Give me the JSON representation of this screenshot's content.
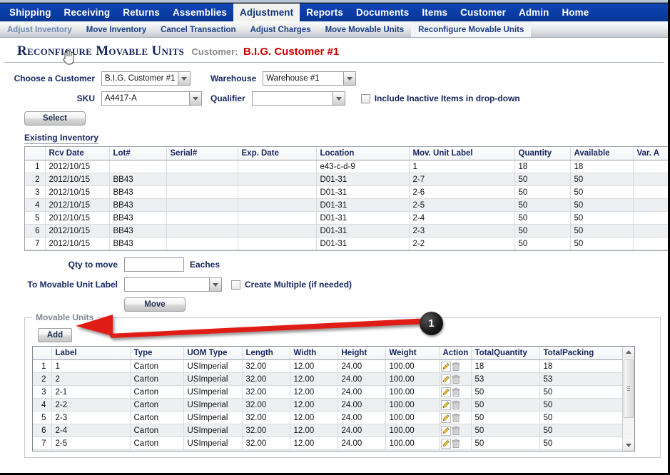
{
  "mainnav": {
    "items": [
      {
        "label": "Shipping",
        "active": false
      },
      {
        "label": "Receiving",
        "active": false
      },
      {
        "label": "Returns",
        "active": false
      },
      {
        "label": "Assemblies",
        "active": false
      },
      {
        "label": "Adjustment",
        "active": true
      },
      {
        "label": "Reports",
        "active": false
      },
      {
        "label": "Documents",
        "active": false
      },
      {
        "label": "Items",
        "active": false
      },
      {
        "label": "Customer",
        "active": false
      },
      {
        "label": "Admin",
        "active": false
      },
      {
        "label": "Home",
        "active": false
      }
    ]
  },
  "subnav": {
    "items": [
      {
        "label": "Adjust Inventory",
        "state": "hover"
      },
      {
        "label": "Move Inventory",
        "state": "normal"
      },
      {
        "label": "Cancel Transaction",
        "state": "normal"
      },
      {
        "label": "Adjust Charges",
        "state": "normal"
      },
      {
        "label": "Move Movable Units",
        "state": "normal"
      },
      {
        "label": "Reconfigure Movable Units",
        "state": "active"
      }
    ]
  },
  "page": {
    "title": "Reconfigure Movable Units",
    "customer_label": "Customer:",
    "customer_name": "B.I.G. Customer #1"
  },
  "form": {
    "customer_label": "Choose a Customer",
    "customer_value": "B.I.G. Customer #1",
    "warehouse_label": "Warehouse",
    "warehouse_value": "Warehouse #1",
    "sku_label": "SKU",
    "sku_value": "A4417-A",
    "qualifier_label": "Qualifier",
    "qualifier_value": "",
    "include_inactive_label": "Include Inactive Items in drop-down",
    "include_inactive_checked": false,
    "select_button": "Select"
  },
  "existing_inventory": {
    "caption": "Existing Inventory",
    "columns": [
      "",
      "Rcv Date",
      "Lot#",
      "Serial#",
      "Exp. Date",
      "Location",
      "Mov. Unit Label",
      "Quantity",
      "Available",
      "Var. A"
    ],
    "rows": [
      [
        "1",
        "2012/10/15",
        "",
        "",
        "",
        "e43-c-d-9",
        "1",
        "18",
        "18",
        ""
      ],
      [
        "2",
        "2012/10/15",
        "BB43",
        "",
        "",
        "D01-31",
        "2-7",
        "50",
        "50",
        ""
      ],
      [
        "3",
        "2012/10/15",
        "BB43",
        "",
        "",
        "D01-31",
        "2-6",
        "50",
        "50",
        ""
      ],
      [
        "4",
        "2012/10/15",
        "BB43",
        "",
        "",
        "D01-31",
        "2-5",
        "50",
        "50",
        ""
      ],
      [
        "5",
        "2012/10/15",
        "BB43",
        "",
        "",
        "D01-31",
        "2-4",
        "50",
        "50",
        ""
      ],
      [
        "6",
        "2012/10/15",
        "BB43",
        "",
        "",
        "D01-31",
        "2-3",
        "50",
        "50",
        ""
      ],
      [
        "7",
        "2012/10/15",
        "BB43",
        "",
        "",
        "D01-31",
        "2-2",
        "50",
        "50",
        ""
      ]
    ]
  },
  "move": {
    "qty_label": "Qty to move",
    "qty_value": "",
    "uom_label": "Eaches",
    "to_label": "To Movable Unit Label",
    "to_value": "",
    "create_multiple_label": "Create Multiple (if needed)",
    "create_multiple_checked": false,
    "move_button": "Move"
  },
  "movable_units": {
    "legend": "Movable Units",
    "add_button": "Add",
    "columns": [
      "",
      "Label",
      "Type",
      "UOM Type",
      "Length",
      "Width",
      "Height",
      "Weight",
      "Action",
      "TotalQuantity",
      "TotalPacking"
    ],
    "action_icons": [
      "edit-icon",
      "delete-icon"
    ],
    "rows": [
      [
        "1",
        "1",
        "Carton",
        "USImperial",
        "32.00",
        "12.00",
        "24.00",
        "100.00",
        "",
        "18",
        "18"
      ],
      [
        "2",
        "2",
        "Carton",
        "USImperial",
        "32.00",
        "12.00",
        "24.00",
        "100.00",
        "",
        "53",
        "53"
      ],
      [
        "3",
        "2-1",
        "Carton",
        "USImperial",
        "32.00",
        "12.00",
        "24.00",
        "100.00",
        "",
        "50",
        "50"
      ],
      [
        "4",
        "2-2",
        "Carton",
        "USImperial",
        "32.00",
        "12.00",
        "24.00",
        "100.00",
        "",
        "50",
        "50"
      ],
      [
        "5",
        "2-3",
        "Carton",
        "USImperial",
        "32.00",
        "12.00",
        "24.00",
        "100.00",
        "",
        "50",
        "50"
      ],
      [
        "6",
        "2-4",
        "Carton",
        "USImperial",
        "32.00",
        "12.00",
        "24.00",
        "100.00",
        "",
        "50",
        "50"
      ],
      [
        "7",
        "2-5",
        "Carton",
        "USImperial",
        "32.00",
        "12.00",
        "24.00",
        "100.00",
        "",
        "50",
        "50"
      ]
    ]
  },
  "annotation": {
    "badge_number": "1",
    "arrow_color": "#e01b14"
  },
  "colors": {
    "nav_blue": "#0a3ea8",
    "heading_navy": "#14255e",
    "customer_red": "#cc0000",
    "annotation_red": "#e01b14"
  }
}
